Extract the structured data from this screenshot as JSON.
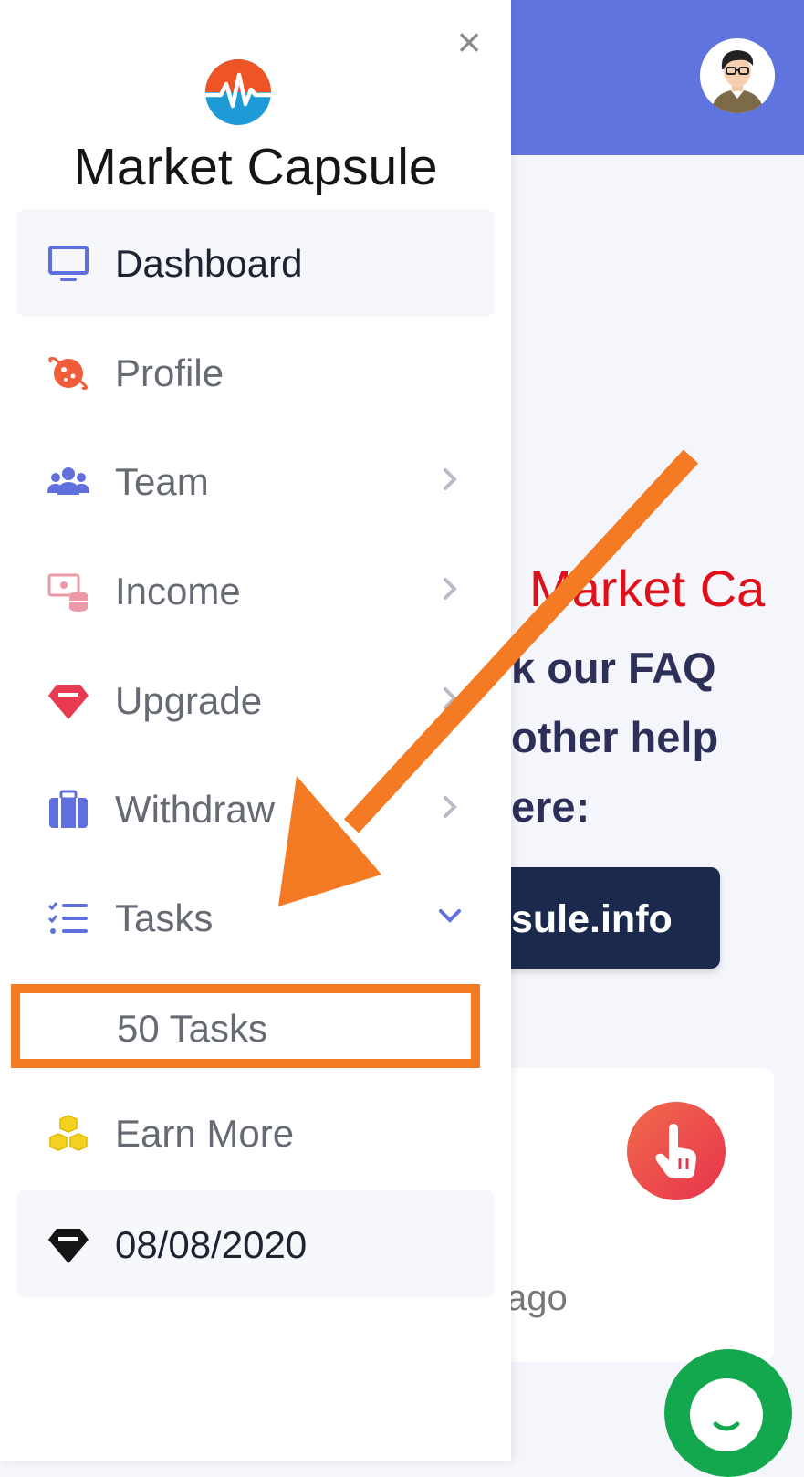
{
  "background": {
    "heading_fragment": "Market Ca",
    "text_lines": [
      "k our FAQ",
      "other help",
      "ere:"
    ],
    "button_fragment": "sule.info",
    "card_time_fragment": "ago"
  },
  "drawer": {
    "close_symbol": "×",
    "brand": "Market Capsule",
    "items": [
      {
        "label": "Dashboard",
        "icon": "monitor-icon",
        "active": true
      },
      {
        "label": "Profile",
        "icon": "planet-icon"
      },
      {
        "label": "Team",
        "icon": "users-icon",
        "chevron": "right"
      },
      {
        "label": "Income",
        "icon": "money-stack-icon",
        "chevron": "right"
      },
      {
        "label": "Upgrade",
        "icon": "gem-icon",
        "chevron": "right"
      },
      {
        "label": "Withdraw",
        "icon": "briefcase-icon",
        "chevron": "right"
      },
      {
        "label": "Tasks",
        "icon": "task-list-icon",
        "chevron": "down"
      },
      {
        "label": "Earn More",
        "icon": "cubes-icon"
      },
      {
        "label": "08/08/2020",
        "icon": "diamond-icon",
        "active": true
      }
    ],
    "tasks_submenu": [
      {
        "label": "50 Tasks"
      }
    ]
  },
  "colors": {
    "topbar": "#6074e0",
    "annotation": "#f47b23",
    "heading_red": "#e0101a",
    "button_navy": "#1b2a4c",
    "chat_green": "#14a84e"
  }
}
